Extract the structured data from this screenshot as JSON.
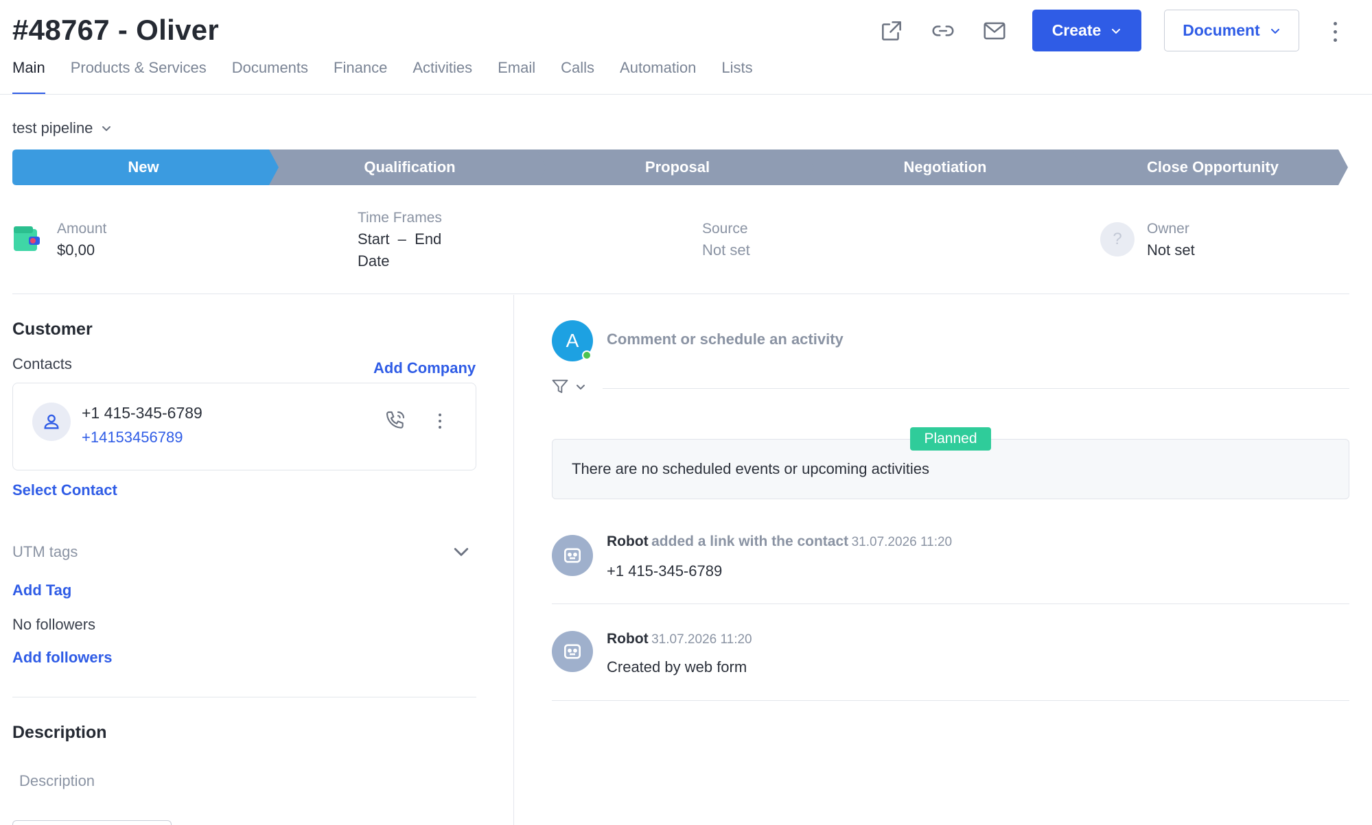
{
  "header": {
    "title": "#48767 - Oliver",
    "icons": [
      "external-link-icon",
      "link-icon",
      "mail-icon"
    ],
    "create_label": "Create",
    "document_label": "Document"
  },
  "tabs": [
    {
      "label": "Main",
      "active": true
    },
    {
      "label": "Products & Services"
    },
    {
      "label": "Documents"
    },
    {
      "label": "Finance"
    },
    {
      "label": "Activities"
    },
    {
      "label": "Email"
    },
    {
      "label": "Calls"
    },
    {
      "label": "Automation"
    },
    {
      "label": "Lists"
    }
  ],
  "pipeline": {
    "name": "test pipeline",
    "stages": [
      {
        "label": "New",
        "active": true
      },
      {
        "label": "Qualification"
      },
      {
        "label": "Proposal"
      },
      {
        "label": "Negotiation"
      },
      {
        "label": "Close Opportunity"
      }
    ]
  },
  "summary": {
    "amount_label": "Amount",
    "amount_value": "$0,00",
    "timeframes_label": "Time Frames",
    "timeframes_line1": "Start  –  End",
    "timeframes_line2": "Date",
    "source_label": "Source",
    "source_value": "Not set",
    "owner_label": "Owner",
    "owner_value": "Not set",
    "owner_avatar_glyph": "?"
  },
  "customer": {
    "title": "Customer",
    "contacts_label": "Contacts",
    "add_company": "Add Company",
    "contact_name": "+1 415-345-6789",
    "contact_phone": "+14153456789",
    "select_contact": "Select Contact",
    "utm_label": "UTM tags",
    "add_tag": "Add Tag",
    "no_followers": "No followers",
    "add_followers": "Add followers"
  },
  "description": {
    "title": "Description",
    "placeholder": "Description"
  },
  "activity": {
    "user_initial": "A",
    "comment_placeholder": "Comment or schedule an activity",
    "planned_badge": "Planned",
    "planned_text": "There are no scheduled events or upcoming activities",
    "feed": [
      {
        "name": "Robot",
        "action": "added a link with the contact",
        "date": "31.07.2026 11:20",
        "text": "+1 415-345-6789"
      },
      {
        "name": "Robot",
        "action": "",
        "date": "31.07.2026 11:20",
        "text": "Created by web form"
      }
    ]
  },
  "colors": {
    "accent": "#2f5ce6",
    "stage_active": "#3b9be0",
    "stage_inactive": "#8f9cb3",
    "planned": "#2fcc9a",
    "avatar": "#1da1e2"
  }
}
